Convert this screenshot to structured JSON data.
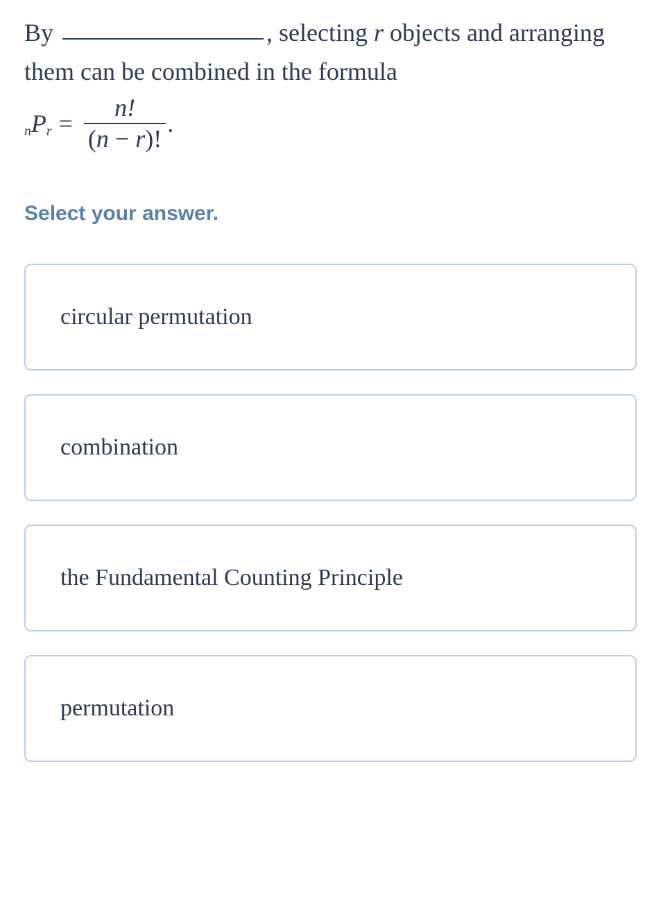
{
  "question": {
    "prefix": "By ",
    "after_blank": ", selecting ",
    "var_r": "r",
    "after_r": " objects and arranging them can be combined in the formula",
    "formula": {
      "left_sub1": "n",
      "P": "P",
      "left_sub2": "r",
      "equals": "=",
      "num": "n!",
      "den_open": "(",
      "den_n": "n",
      "den_minus": " − ",
      "den_r": "r",
      "den_close": ")!",
      "period": "."
    }
  },
  "instruction": "Select your answer.",
  "options": [
    {
      "label": "circular permutation"
    },
    {
      "label": "combination"
    },
    {
      "label": "the Fundamental Counting Principle"
    },
    {
      "label": "permutation"
    }
  ]
}
